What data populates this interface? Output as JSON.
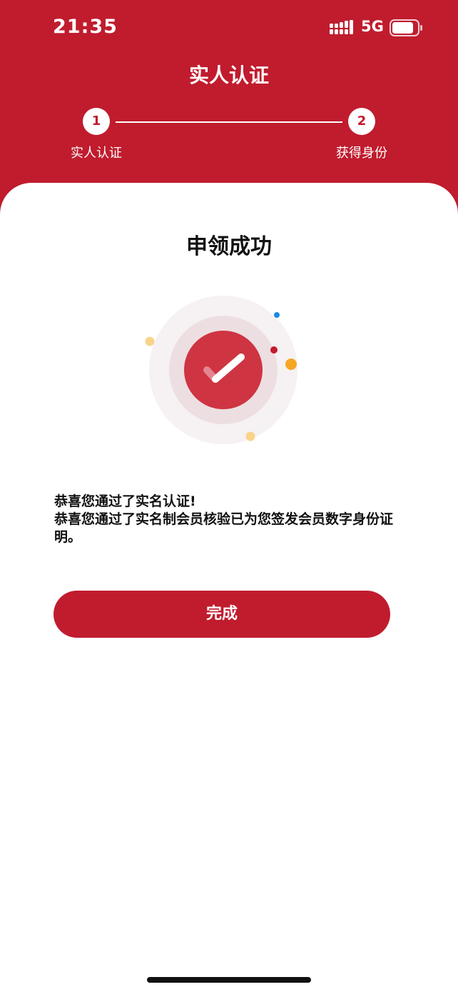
{
  "status_bar": {
    "time": "21:35",
    "network": "5G"
  },
  "header": {
    "title": "实人认证"
  },
  "steps": [
    {
      "number": "1",
      "label": "实人认证"
    },
    {
      "number": "2",
      "label": "获得身份"
    }
  ],
  "content": {
    "title": "申领成功",
    "message_line1": "恭喜您通过了实名认证!",
    "message_line2": "恭喜您通过了实名制会员核验已为您签发会员数字身份证明。"
  },
  "actions": {
    "done_label": "完成"
  },
  "colors": {
    "brand": "#c01c2e",
    "dot_blue": "#1e88e5",
    "dot_orange": "#f5a623",
    "dot_yellow": "#f8d38a"
  },
  "icons": {
    "check": "checkmark-icon",
    "signal": "signal-icon",
    "battery": "battery-icon"
  }
}
